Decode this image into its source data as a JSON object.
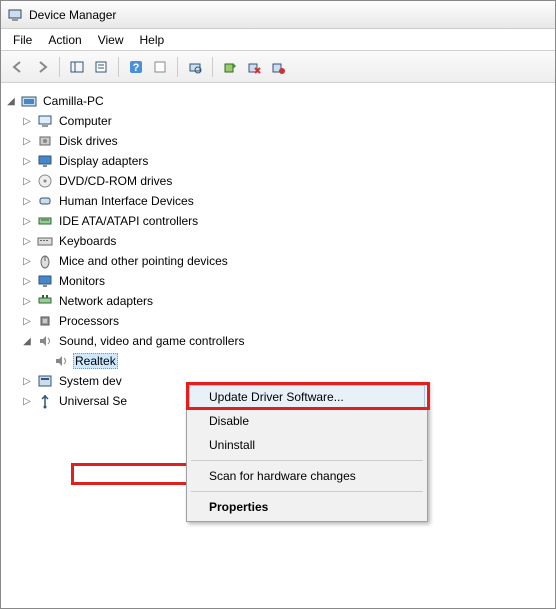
{
  "window": {
    "title": "Device Manager"
  },
  "menubar": [
    "File",
    "Action",
    "View",
    "Help"
  ],
  "tree": {
    "root": "Camilla-PC",
    "nodes": [
      {
        "label": "Computer",
        "icon": "computer"
      },
      {
        "label": "Disk drives",
        "icon": "disk"
      },
      {
        "label": "Display adapters",
        "icon": "display"
      },
      {
        "label": "DVD/CD-ROM drives",
        "icon": "dvd"
      },
      {
        "label": "Human Interface Devices",
        "icon": "hid"
      },
      {
        "label": "IDE ATA/ATAPI controllers",
        "icon": "ide"
      },
      {
        "label": "Keyboards",
        "icon": "keyboard"
      },
      {
        "label": "Mice and other pointing devices",
        "icon": "mouse"
      },
      {
        "label": "Monitors",
        "icon": "monitor"
      },
      {
        "label": "Network adapters",
        "icon": "network"
      },
      {
        "label": "Processors",
        "icon": "cpu"
      },
      {
        "label": "Sound, video and game controllers",
        "icon": "sound",
        "expanded": true,
        "children": [
          {
            "label": "Realtek",
            "icon": "sound",
            "selected": true
          }
        ]
      },
      {
        "label": "System dev",
        "icon": "system"
      },
      {
        "label": "Universal Se",
        "icon": "usb"
      }
    ]
  },
  "context_menu": {
    "items": [
      {
        "label": "Update Driver Software...",
        "highlighted": true
      },
      {
        "label": "Disable"
      },
      {
        "label": "Uninstall"
      },
      {
        "sep": true
      },
      {
        "label": "Scan for hardware changes"
      },
      {
        "sep": true
      },
      {
        "label": "Properties",
        "bold": true
      }
    ]
  }
}
